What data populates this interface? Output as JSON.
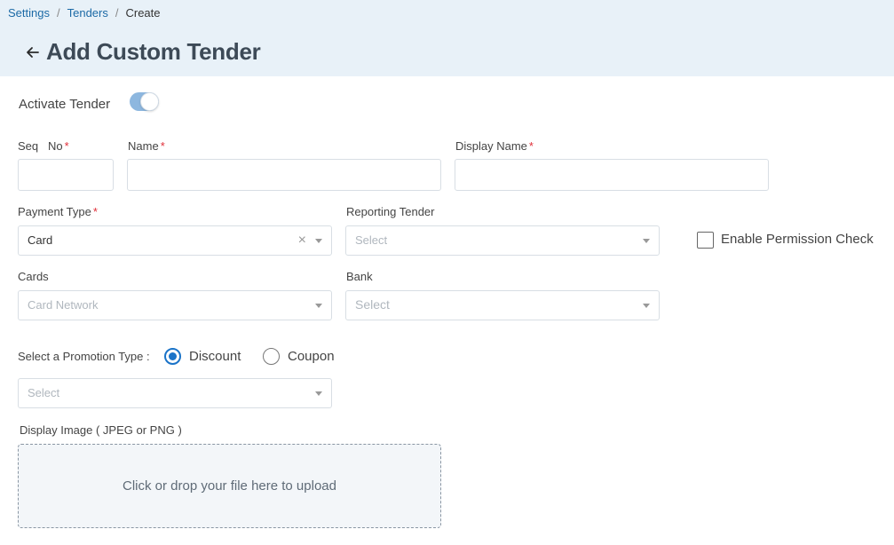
{
  "breadcrumb": {
    "items": [
      "Settings",
      "Tenders"
    ],
    "current": "Create",
    "separator": "/"
  },
  "header": {
    "title": "Add Custom Tender",
    "back_icon": "arrow-left-icon"
  },
  "form": {
    "activate": {
      "label": "Activate Tender",
      "on": true
    },
    "seq_no": {
      "label": "Seq   No",
      "required_mark": "*",
      "value": ""
    },
    "name": {
      "label": "Name",
      "required_mark": "*",
      "value": ""
    },
    "display_name": {
      "label": "Display Name",
      "required_mark": "*",
      "value": ""
    },
    "payment_type": {
      "label": "Payment Type",
      "required_mark": "*",
      "value": "Card",
      "clear_glyph": "×"
    },
    "reporting_tender": {
      "label": "Reporting Tender",
      "placeholder": "Select"
    },
    "enable_permission_check": {
      "label": "Enable Permission Check",
      "checked": false
    },
    "cards": {
      "label": "Cards",
      "placeholder": "Card Network"
    },
    "bank": {
      "label": "Bank",
      "placeholder": "Select"
    },
    "promotion": {
      "label": "Select a Promotion Type :",
      "options": [
        "Discount",
        "Coupon"
      ],
      "selected": "Discount",
      "select_placeholder": "Select"
    },
    "display_image": {
      "label": "Display Image ( JPEG or PNG )",
      "dropzone_text": "Click or drop your file here to upload"
    }
  },
  "colors": {
    "header_bg": "#e8f1f8",
    "link": "#1c6aa6",
    "required": "#e0303a",
    "accent": "#1a73c8",
    "toggle_on": "#8db7df"
  }
}
